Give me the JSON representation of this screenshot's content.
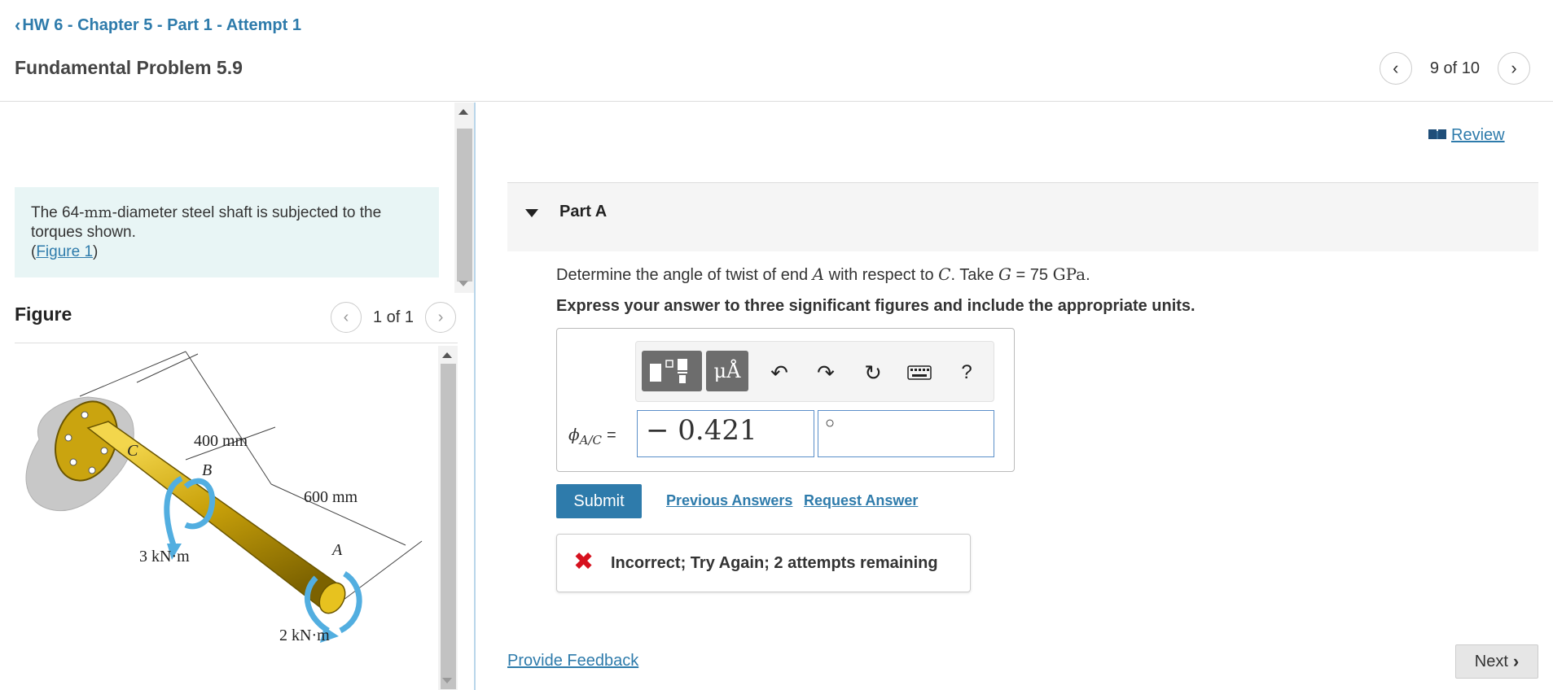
{
  "header": {
    "back_label": "HW 6 - Chapter 5 - Part 1 - Attempt 1",
    "problem_title": "Fundamental Problem 5.9",
    "pager_text": "9 of 10"
  },
  "problem": {
    "text_before": "The 64-",
    "unit": "mm",
    "text_after": "-diameter steel shaft is subjected to the torques shown.",
    "figure_link": "Figure 1"
  },
  "figure": {
    "label": "Figure",
    "pager_text": "1 of 1",
    "labels": {
      "dim1": "400 mm",
      "dim2": "600 mm",
      "point_c": "C",
      "point_b": "B",
      "point_a": "A",
      "torque_b": "3 kN·m",
      "torque_a": "2 kN·m"
    }
  },
  "review_label": "Review",
  "part": {
    "title": "Part A",
    "question_1": "Determine the angle of twist of end ",
    "var_a": "A",
    "question_2": " with respect to ",
    "var_c": "C",
    "question_3": ". Take ",
    "var_g": "G",
    "question_4": " = 75 ",
    "unit_gpa": "GPa",
    "question_5": ".",
    "instruction": "Express your answer to three significant figures and include the appropriate units."
  },
  "toolbar": {
    "units_label": "μÅ",
    "help_label": "?"
  },
  "answer": {
    "phi_symbol": "ϕ",
    "phi_sub": "A/C",
    "equals": "=",
    "value": "− 0.421",
    "unit_value": "○"
  },
  "actions": {
    "submit_label": "Submit",
    "previous_answers": "Previous Answers",
    "request_answer": "Request Answer"
  },
  "feedback": {
    "icon": "✖",
    "message": "Incorrect; Try Again; 2 attempts remaining"
  },
  "footer": {
    "provide_feedback": "Provide Feedback",
    "next_label": "Next"
  },
  "colors": {
    "link": "#2e7bab",
    "error": "#d6111e",
    "problem_bg": "#e8f5f5"
  }
}
